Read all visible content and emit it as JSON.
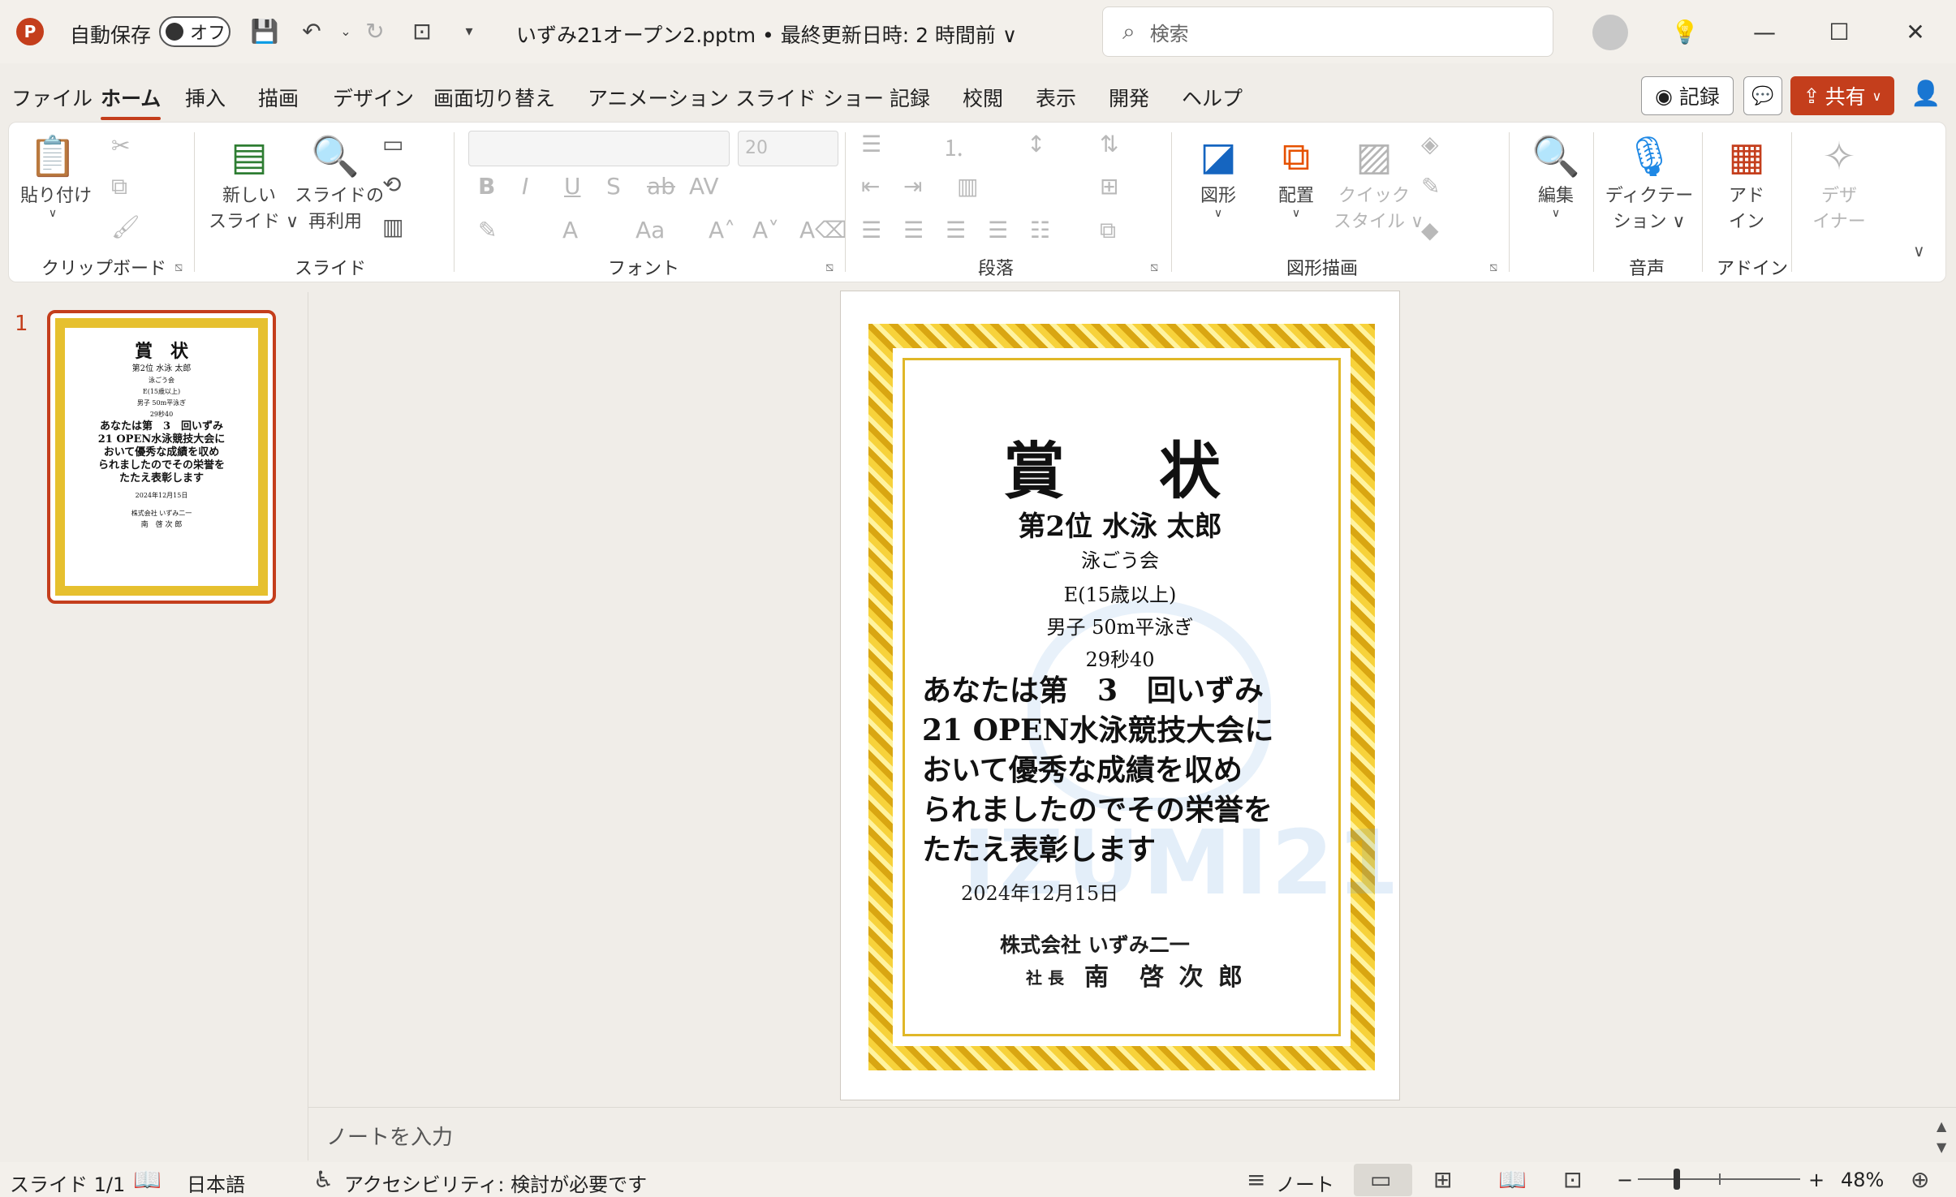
{
  "titlebar": {
    "app_letter": "P",
    "autosave_label": "自動保存",
    "toggle_state": "オフ",
    "doc_title": "いずみ21オープン2.pptm • 最終更新日時: 2 時間前 ∨",
    "search_placeholder": "検索"
  },
  "menu": {
    "tabs": [
      "ファイル",
      "ホーム",
      "挿入",
      "描画",
      "デザイン",
      "画面切り替え",
      "アニメーション",
      "スライド ショー",
      "記録",
      "校閲",
      "表示",
      "開発",
      "ヘルプ"
    ],
    "active_tab": "ホーム",
    "record_label": "記録",
    "share_label": "共有"
  },
  "ribbon": {
    "clipboard": {
      "paste": "貼り付け",
      "group": "クリップボード"
    },
    "slides": {
      "new_slide_1": "新しい",
      "new_slide_2": "スライド ∨",
      "reuse_1": "スライドの",
      "reuse_2": "再利用",
      "group": "スライド"
    },
    "font": {
      "font_size": "20",
      "group": "フォント"
    },
    "paragraph": {
      "group": "段落"
    },
    "drawing": {
      "shapes": "図形",
      "arrange": "配置",
      "quick_style_1": "クイック",
      "quick_style_2": "スタイル ∨",
      "group": "図形描画"
    },
    "editing": {
      "edit": "編集"
    },
    "voice": {
      "dictate_1": "ディクテー",
      "dictate_2": "ション ∨",
      "group": "音声"
    },
    "addins": {
      "addin_1": "アド",
      "addin_2": "イン",
      "group": "アドイン"
    },
    "designer": {
      "designer_1": "デザ",
      "designer_2": "イナー"
    }
  },
  "thumbnail": {
    "slide_number": "1"
  },
  "certificate": {
    "title": "賞　状",
    "rank_line": "第2位  水泳  太郎",
    "club": "泳ごう会",
    "category": "E(15歳以上)",
    "event": "男子  50m平泳ぎ",
    "time": "29秒40",
    "body_lines": [
      "あなたは第　3　回いずみ",
      "21 OPEN水泳競技大会に",
      "おいて優秀な成績を収め",
      "られましたのでその栄誉を",
      "たたえ表彰します"
    ],
    "date": "2024年12月15日",
    "company": "株式会社 いずみ二一",
    "president_title": "社 長",
    "president_name": "南　啓 次 郎",
    "watermark": "IZUMI21"
  },
  "notes": {
    "placeholder": "ノートを入力"
  },
  "status": {
    "slide_info": "スライド 1/1",
    "language": "日本語",
    "accessibility": "アクセシビリティ: 検討が必要です",
    "notes_label": "ノート",
    "zoom": "48%"
  },
  "colors": {
    "accent": "#c43e1c",
    "gold": "#e0b728"
  }
}
